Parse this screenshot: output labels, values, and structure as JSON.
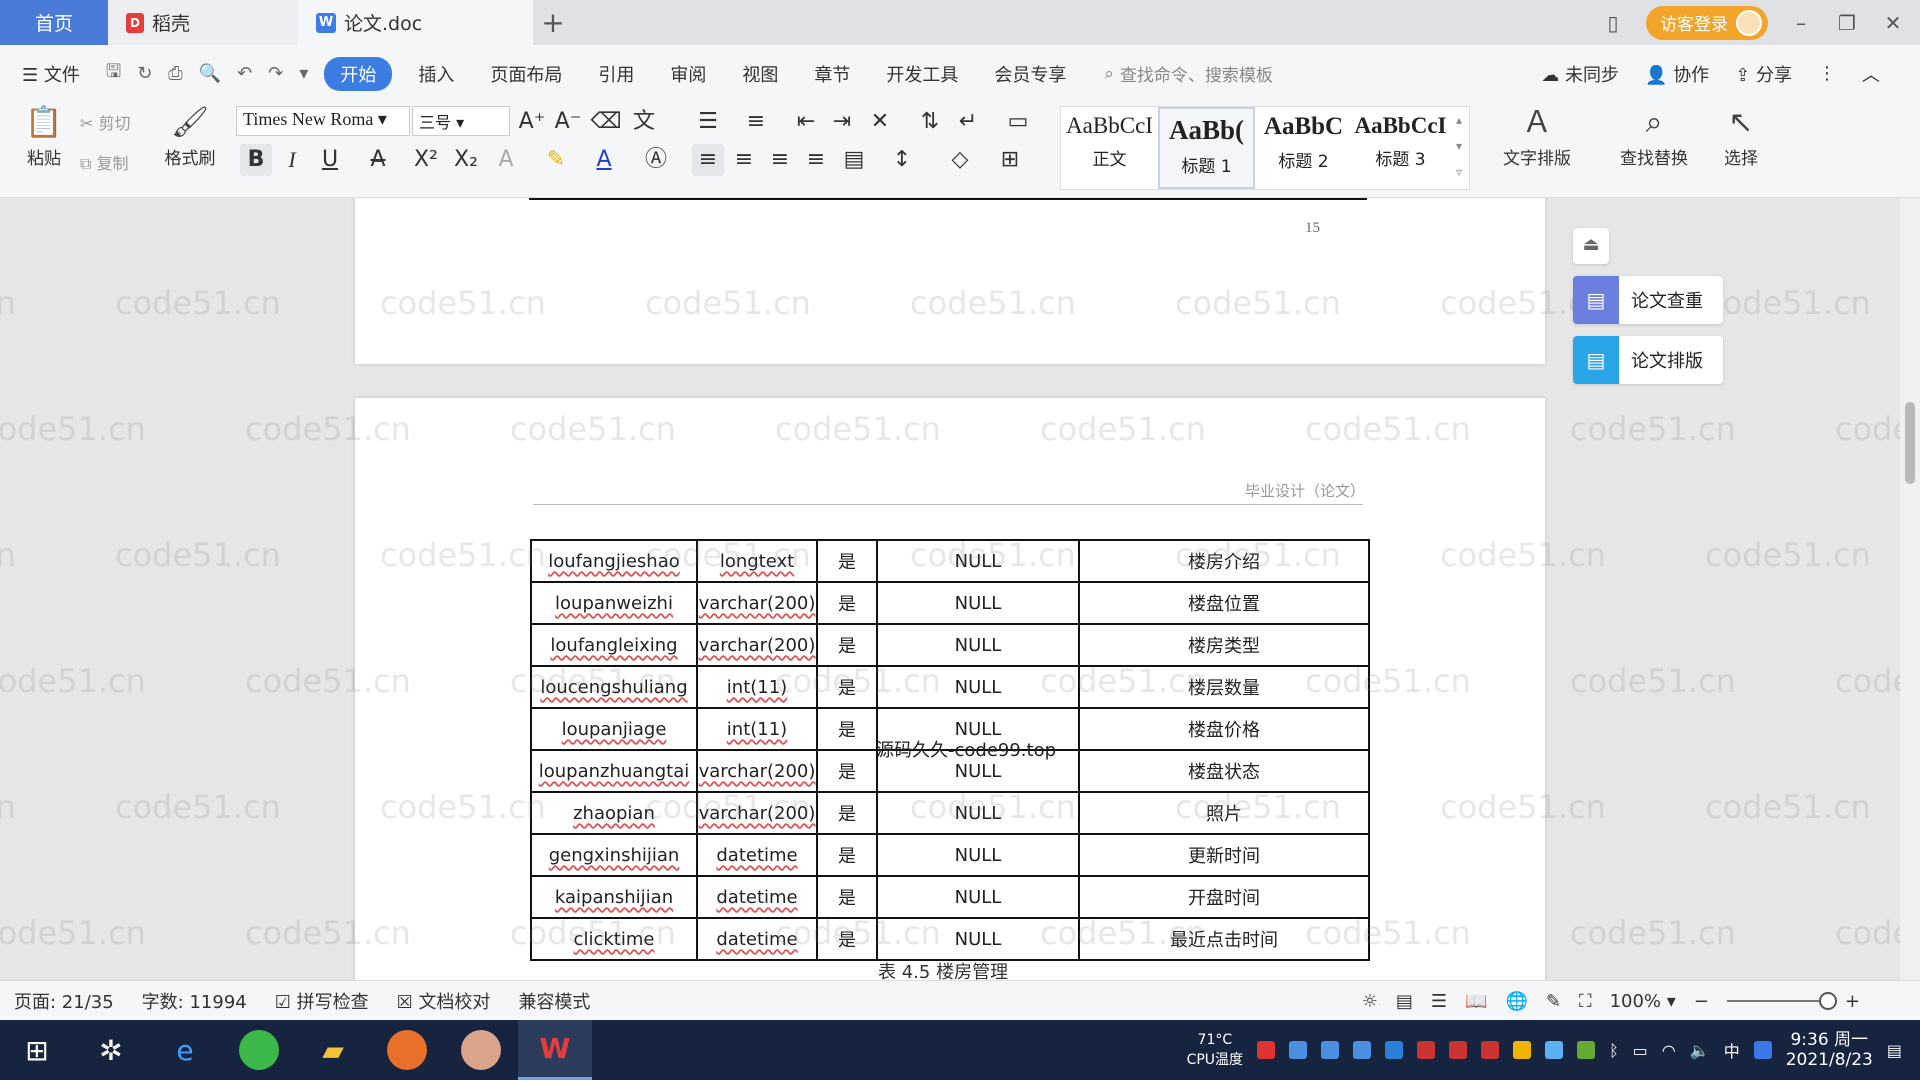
{
  "tabs": {
    "home": "首页",
    "daoke": "稻壳",
    "doc": "论文.doc",
    "new": "+"
  },
  "titlebar": {
    "guest_login": "访客登录"
  },
  "menu": {
    "file": "文件",
    "items": [
      "开始",
      "插入",
      "页面布局",
      "引用",
      "审阅",
      "视图",
      "章节",
      "开发工具",
      "会员专享"
    ],
    "search_placeholder": "查找命令、搜索模板",
    "sync": "未同步",
    "collab": "协作",
    "share": "分享"
  },
  "ribbon": {
    "paste": "粘贴",
    "cut": "剪切",
    "copy": "复制",
    "format_painter": "格式刷",
    "font_name": "Times New Roma",
    "font_size": "三号",
    "styles": [
      {
        "preview": "AaBbCcI",
        "name": "正文"
      },
      {
        "preview": "AaBb(",
        "name": "标题 1"
      },
      {
        "preview": "AaBbC",
        "name": "标题 2"
      },
      {
        "preview": "AaBbCcI",
        "name": "标题 3"
      }
    ],
    "text_layout": "文字排版",
    "find_replace": "查找替换",
    "select": "选择"
  },
  "document": {
    "page_number": "15",
    "header_text": "毕业设计（论文）",
    "watermark": "code51.cn",
    "stamp": "源码久久-code99.top",
    "rows": [
      [
        "loufangjieshao",
        "longtext",
        "是",
        "NULL",
        "楼房介绍"
      ],
      [
        "loupanweizhi",
        "varchar(200)",
        "是",
        "NULL",
        "楼盘位置"
      ],
      [
        "loufangleixing",
        "varchar(200)",
        "是",
        "NULL",
        "楼房类型"
      ],
      [
        "loucengshuliang",
        "int(11)",
        "是",
        "NULL",
        "楼层数量"
      ],
      [
        "loupanjiage",
        "int(11)",
        "是",
        "NULL",
        "楼盘价格"
      ],
      [
        "loupanzhuangtai",
        "varchar(200)",
        "是",
        "NULL",
        "楼盘状态"
      ],
      [
        "zhaopian",
        "varchar(200)",
        "是",
        "NULL",
        "照片"
      ],
      [
        "gengxinshijian",
        "datetime",
        "是",
        "NULL",
        "更新时间"
      ],
      [
        "kaipanshijian",
        "datetime",
        "是",
        "NULL",
        "开盘时间"
      ],
      [
        "clicktime",
        "datetime",
        "是",
        "NULL",
        "最近点击时间"
      ]
    ],
    "caption": "表 4.5 楼房管理"
  },
  "side_panel": {
    "check": "论文查重",
    "layout": "论文排版"
  },
  "status": {
    "page": "页面: 21/35",
    "words": "字数: 11994",
    "spell": "拼写检查",
    "proof": "文档校对",
    "compat": "兼容模式",
    "zoom": "100%"
  },
  "taskbar": {
    "cpu_temp": "71°C",
    "cpu_label": "CPU温度",
    "ime": "中",
    "time": "9:36 周一",
    "date": "2021/8/23"
  }
}
